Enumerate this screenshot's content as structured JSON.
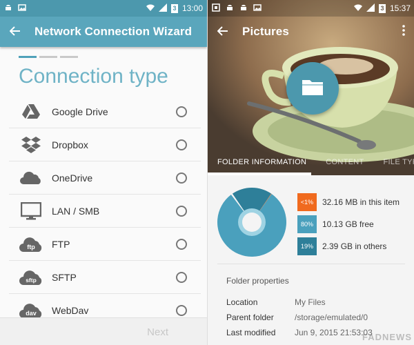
{
  "left": {
    "status": {
      "time": "13:00",
      "battery_glyph": "3"
    },
    "appbar": {
      "title": "Network Connection Wizard"
    },
    "heading": "Connection type",
    "options": [
      {
        "label": "Google Drive",
        "icon": "google-drive-icon"
      },
      {
        "label": "Dropbox",
        "icon": "dropbox-icon"
      },
      {
        "label": "OneDrive",
        "icon": "onedrive-icon"
      },
      {
        "label": "LAN / SMB",
        "icon": "monitor-icon"
      },
      {
        "label": "FTP",
        "icon": "ftp-cloud-icon",
        "badge": "ftp"
      },
      {
        "label": "SFTP",
        "icon": "sftp-cloud-icon",
        "badge": "sftp"
      },
      {
        "label": "WebDav",
        "icon": "webdav-cloud-icon",
        "badge": "dav"
      }
    ],
    "footer": {
      "next_label": "Next"
    }
  },
  "right": {
    "status": {
      "time": "15:37",
      "battery_glyph": "3"
    },
    "appbar": {
      "title": "Pictures"
    },
    "tabs": [
      "FOLDER INFORMATION",
      "CONTENT",
      "FILE TYPES"
    ],
    "storage_chart": {
      "segments": [
        {
          "chip": "<1%",
          "text": "32.16 MB in this item",
          "fraction": 0.002,
          "color": "#f06a1e"
        },
        {
          "chip": "80%",
          "text": "10.13 GB free",
          "fraction": 0.8,
          "color": "#4aa0bd"
        },
        {
          "chip": "19%",
          "text": "2.39 GB in others",
          "fraction": 0.19,
          "color": "#2e7f99"
        }
      ]
    },
    "properties": {
      "header": "Folder properties",
      "rows": [
        {
          "key": "Location",
          "value": "My Files"
        },
        {
          "key": "Parent folder",
          "value": "/storage/emulated/0"
        },
        {
          "key": "Last modified",
          "value": "Jun 9, 2015 21:53:03"
        }
      ]
    },
    "watermark": "FADNEWS"
  },
  "colors": {
    "accent": "#5aa6bc",
    "accent_dark": "#4c98ad",
    "heading": "#6fb3c6"
  }
}
